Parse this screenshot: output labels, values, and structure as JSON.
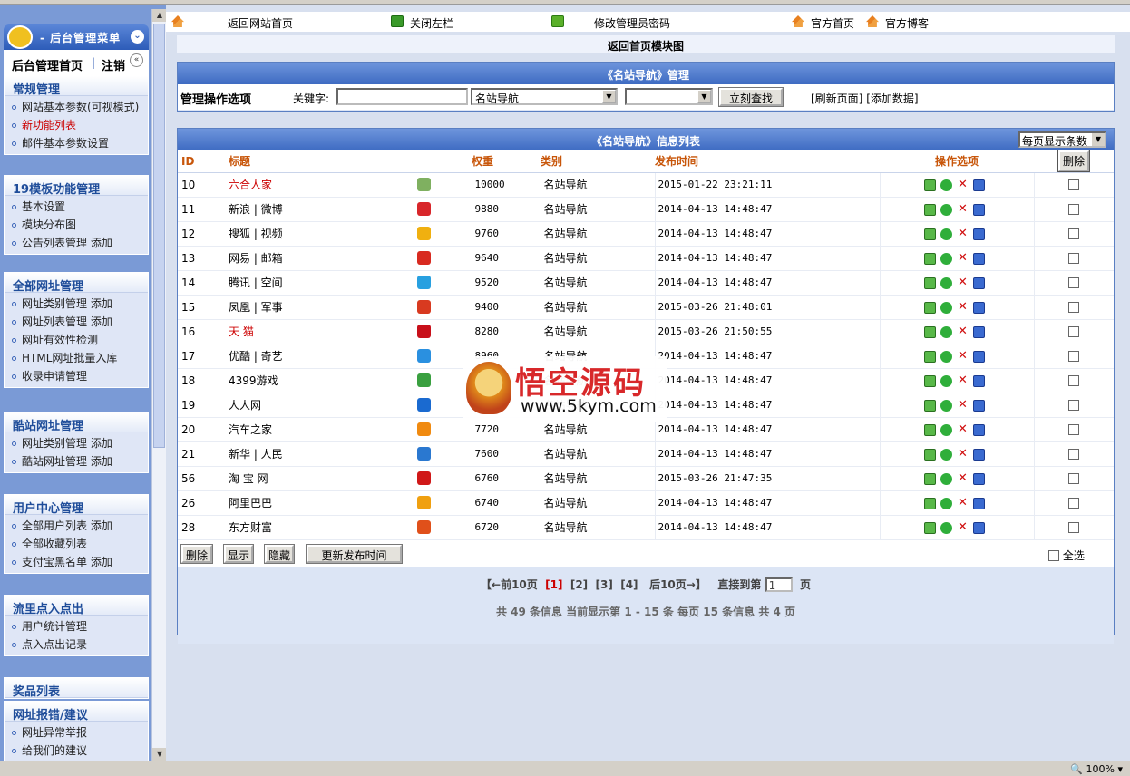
{
  "sidebar": {
    "menu_title": "- 后台管理菜单",
    "home_label": "后台管理首页",
    "separator": "|",
    "logout_label": "注销",
    "groups": [
      {
        "title": "常规管理",
        "items": [
          {
            "label": "网站基本参数(可视模式)",
            "red": false
          },
          {
            "label": "新功能列表",
            "red": true
          },
          {
            "label": "邮件基本参数设置",
            "red": false
          }
        ]
      },
      {
        "title": "19模板功能管理",
        "items": [
          {
            "label": "基本设置",
            "red": false
          },
          {
            "label": "模块分布图",
            "red": false
          },
          {
            "label": "公告列表管理 添加",
            "red": false
          }
        ]
      },
      {
        "title": "全部网址管理",
        "items": [
          {
            "label": "网址类别管理 添加",
            "red": false
          },
          {
            "label": "网址列表管理 添加",
            "red": false
          },
          {
            "label": "网址有效性检测",
            "red": false
          },
          {
            "label": "HTML网址批量入库",
            "red": false
          },
          {
            "label": "收录申请管理",
            "red": false
          }
        ]
      },
      {
        "title": "酷站网址管理",
        "items": [
          {
            "label": "网址类别管理 添加",
            "red": false
          },
          {
            "label": "酷站网址管理 添加",
            "red": false
          }
        ]
      },
      {
        "title": "用户中心管理",
        "items": [
          {
            "label": "全部用户列表 添加",
            "red": false
          },
          {
            "label": "全部收藏列表",
            "red": false
          },
          {
            "label": "支付宝黑名单 添加",
            "red": false
          }
        ]
      },
      {
        "title": "流里点入点出",
        "items": [
          {
            "label": "用户统计管理",
            "red": false
          },
          {
            "label": "点入点出记录",
            "red": false
          }
        ]
      },
      {
        "title": "奖品列表",
        "items": []
      },
      {
        "title": "网址报错/建议",
        "items": [
          {
            "label": "网址异常举报",
            "red": false
          },
          {
            "label": "给我们的建议",
            "red": false
          }
        ]
      }
    ]
  },
  "toolbar": {
    "back_home": "返回网站首页",
    "close_left": "关闭左栏",
    "change_admin_pwd": "修改管理员密码",
    "official_home": "官方首页",
    "official_blog": "官方博客"
  },
  "block_title": "返回首页模块图",
  "manage_panel": {
    "title": "《名站导航》管理",
    "options_label": "管理操作选项",
    "keyword_label": "关键字:",
    "keyword_value": "",
    "category_select": "名站导航",
    "second_select": "",
    "search_button": "立刻查找",
    "refresh_link": "[刷新页面]",
    "add_link": "[添加数据]"
  },
  "list_panel": {
    "title": "《名站导航》信息列表",
    "per_page_select": "每页显示条数",
    "columns": [
      "ID",
      "标题",
      "",
      "权重",
      "类别",
      "发布时间",
      "",
      "操作选项",
      "删除"
    ],
    "rows": [
      {
        "id": "10",
        "title": "六合人家",
        "red": true,
        "logo_color": "#7fb060",
        "weight": "10000",
        "category": "名站导航",
        "time": "2015-01-22 23:21:11"
      },
      {
        "id": "11",
        "title": "新浪 | 微博",
        "red": false,
        "logo_color": "#d8262a",
        "weight": "9880",
        "category": "名站导航",
        "time": "2014-04-13 14:48:47"
      },
      {
        "id": "12",
        "title": "搜狐 | 视频",
        "red": false,
        "logo_color": "#f0b010",
        "weight": "9760",
        "category": "名站导航",
        "time": "2014-04-13 14:48:47"
      },
      {
        "id": "13",
        "title": "网易 | 邮箱",
        "red": false,
        "logo_color": "#d82a20",
        "weight": "9640",
        "category": "名站导航",
        "time": "2014-04-13 14:48:47"
      },
      {
        "id": "14",
        "title": "腾讯 | 空间",
        "red": false,
        "logo_color": "#28a0e0",
        "weight": "9520",
        "category": "名站导航",
        "time": "2014-04-13 14:48:47"
      },
      {
        "id": "15",
        "title": "凤凰 | 军事",
        "red": false,
        "logo_color": "#d83a20",
        "weight": "9400",
        "category": "名站导航",
        "time": "2015-03-26 21:48:01"
      },
      {
        "id": "16",
        "title": "天 猫",
        "red": true,
        "logo_color": "#c8101a",
        "weight": "8280",
        "category": "名站导航",
        "time": "2015-03-26 21:50:55"
      },
      {
        "id": "17",
        "title": "优酷 | 奇艺",
        "red": false,
        "logo_color": "#2a90e0",
        "weight": "8960",
        "category": "名站导航",
        "time": "2014-04-13 14:48:47"
      },
      {
        "id": "18",
        "title": "4399游戏",
        "red": false,
        "logo_color": "#3aa040",
        "weight": "8840",
        "category": "名站导航",
        "time": "2014-04-13 14:48:47"
      },
      {
        "id": "19",
        "title": "人人网",
        "red": false,
        "logo_color": "#1a6ad0",
        "weight": "8720",
        "category": "名站导航",
        "time": "2014-04-13 14:48:47"
      },
      {
        "id": "20",
        "title": "汽车之家",
        "red": false,
        "logo_color": "#f08a10",
        "weight": "7720",
        "category": "名站导航",
        "time": "2014-04-13 14:48:47"
      },
      {
        "id": "21",
        "title": "新华 | 人民",
        "red": false,
        "logo_color": "#2a78d0",
        "weight": "7600",
        "category": "名站导航",
        "time": "2014-04-13 14:48:47"
      },
      {
        "id": "56",
        "title": "淘 宝 网",
        "red": false,
        "logo_color": "#d01818",
        "weight": "6760",
        "category": "名站导航",
        "time": "2015-03-26 21:47:35"
      },
      {
        "id": "26",
        "title": "阿里巴巴",
        "red": false,
        "logo_color": "#f0a010",
        "weight": "6740",
        "category": "名站导航",
        "time": "2014-04-13 14:48:47"
      },
      {
        "id": "28",
        "title": "东方财富",
        "red": false,
        "logo_color": "#e0501a",
        "weight": "6720",
        "category": "名站导航",
        "time": "2014-04-13 14:48:47"
      }
    ],
    "actions": {
      "delete": "删除",
      "show": "显示",
      "hide": "隐藏",
      "update_time": "更新发布时间",
      "select_all": "全选"
    },
    "pager": {
      "prev10": "【←前10页",
      "pages": [
        "[1]",
        "[2]",
        "[3]",
        "[4]"
      ],
      "next10": "后10页→】",
      "goto_label": "直接到第",
      "goto_value": "1",
      "page_unit": "页",
      "summary": "共 49 条信息 当前显示第 1 - 15 条 每页 15 条信息 共 4 页"
    }
  },
  "watermark": {
    "brand": "悟空源码",
    "url": "www.5kym.com"
  },
  "statusbar": {
    "zoom": "100%"
  }
}
